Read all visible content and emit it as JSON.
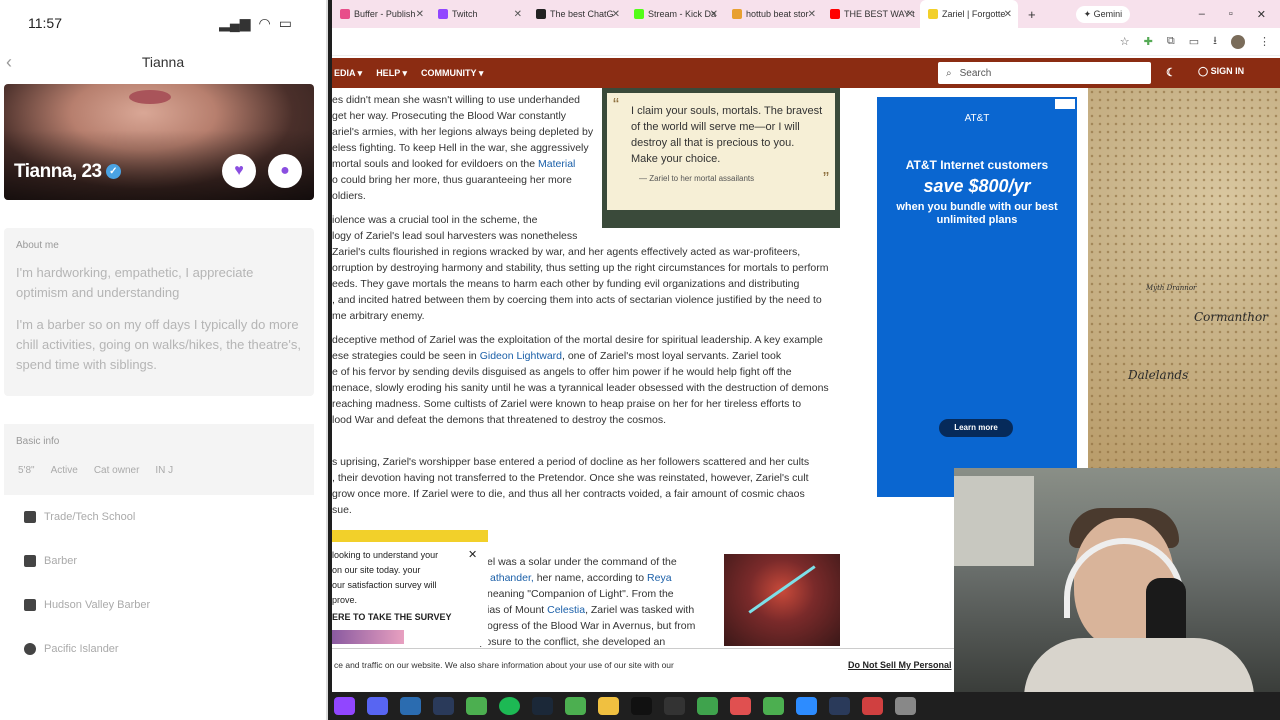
{
  "phone": {
    "time": "11:57",
    "title": "Tianna",
    "name": "Tianna, 23",
    "about_header": "About me",
    "about1": "I'm hardworking, empathetic, I appreciate optimism and understanding",
    "about2": "I'm a barber so on my off days I typically do more chill activities, going on walks/hikes, the theatre's, spend time with siblings.",
    "basic_header": "Basic info",
    "chips": [
      "5'8\"",
      "Active",
      "Cat owner",
      "IN J"
    ],
    "rows": [
      "Trade/Tech School",
      "Barber",
      "Hudson Valley Barber",
      "Pacific Islander"
    ]
  },
  "browser": {
    "tabs": [
      {
        "label": "Buffer - Publish",
        "color": "#e84e8a"
      },
      {
        "label": "Twitch",
        "color": "#9146ff"
      },
      {
        "label": "The best ChatG",
        "color": "#222"
      },
      {
        "label": "Stream - Kick Da",
        "color": "#53fc18"
      },
      {
        "label": "hottub beat stor",
        "color": "#e8a030"
      },
      {
        "label": "THE BEST WAY t",
        "color": "#ff0000"
      },
      {
        "label": "Zariel | Forgotte",
        "color": "#f2d02a"
      }
    ],
    "gemini": "Gemini"
  },
  "nav": {
    "items": [
      "EDIA ▾",
      "HELP ▾",
      "COMMUNITY ▾"
    ],
    "search_placeholder": "Search",
    "signin": "SIGN IN"
  },
  "article": {
    "p1a": "es didn't mean she wasn't willing to use underhanded",
    "p1b": "get her way. Prosecuting the Blood War constantly",
    "p1c": "ariel's armies, with her legions always being depleted by",
    "p1d": "eless fighting. To keep Hell in the war, she aggressively",
    "p1e": "mortal souls and looked for evildoers on the ",
    "p1e_link": "Material",
    "p1f": "o could bring her more, thus guaranteeing her more",
    "p1g": "oldiers.",
    "p2a": "iolence was a crucial tool in the scheme, the",
    "p2b": "logy of Zariel's lead soul harvesters was nonetheless",
    "p2c": " Zariel's cults flourished in regions wracked by war, and her agents effectively acted as war-profiteers,",
    "p2d": "orruption by destroying harmony and stability, thus setting up the right circumstances for mortals to perform",
    "p2e": "eeds. They gave mortals the means to harm each other by funding evil organizations and distributing",
    "p2f": ", and incited hatred between them by coercing them into acts of sectarian violence justified by the need to",
    "p2g": "me arbitrary enemy.",
    "p3a": "deceptive method of Zariel was the exploitation of the mortal desire for spiritual leadership. A key example",
    "p3b": "ese strategies could be seen in ",
    "p3b_link": "Gideon Lightward",
    "p3b2": ", one of Zariel's most loyal servants. Zariel took",
    "p3c": "e of his fervor by sending devils disguised as angels to offer him power if he would help fight off the",
    "p3d": "menace, slowly eroding his sanity until he was a tyrannical leader obsessed with the destruction of demons",
    "p3e": " reaching madness. Some cultists of Zariel were known to heap praise on her for her tireless efforts to",
    "p3f": "lood War and defeat the demons that threatened to destroy the cosmos.",
    "p4a": "s uprising, Zariel's worshipper base entered a period of docline as her followers scattered and her cults",
    "p4b": ", their devotion having not transferred to the Pretendor. Once she was reinstated, however, Zariel's cult",
    "p4c": "grow once more. If Zariel were to die, and thus all her contracts voided, a fair amount of cosmic chaos",
    "p4d": "sue.",
    "p5a": "el was a solar under the command of the",
    "p5b": "athander,",
    "p5b2": " her name, according to ",
    "p5b_link": "Reya",
    "p5c": "neaning \"Companion of Light\". From the",
    "p5d": "ias of Mount ",
    "p5d_link": "Celestia",
    "p5d2": ", Zariel was tasked with",
    "p5e": "ogress of the Blood War in Avernus, but from",
    "p5f": "continued exposure to the conflict, she developed an"
  },
  "quote": {
    "text": "I claim your souls, mortals. The bravest of the world will serve me—or I will destroy all that is precious to you. Make your choice.",
    "attribution": "— Zariel to her mortal assailants"
  },
  "survey": {
    "l1": "looking to understand your",
    "l2": "on our site today. your",
    "l3": "our satisfaction survey will",
    "l4": "prove.",
    "cta": "ERE TO TAKE THE SURVEY"
  },
  "ad": {
    "brand": "AT&T",
    "h1": "AT&T Internet customers",
    "h2": "save $800/yr",
    "h3": "when you bundle with our best unlimited plans",
    "button": "Learn more"
  },
  "map": {
    "labels": [
      "Cormanthor",
      "Dalelands",
      "Myth Drannor"
    ]
  },
  "cookie": {
    "text": "ce and traffic on our website. We also share information about your use of our site with our",
    "dns": "Do Not Sell My Personal"
  }
}
